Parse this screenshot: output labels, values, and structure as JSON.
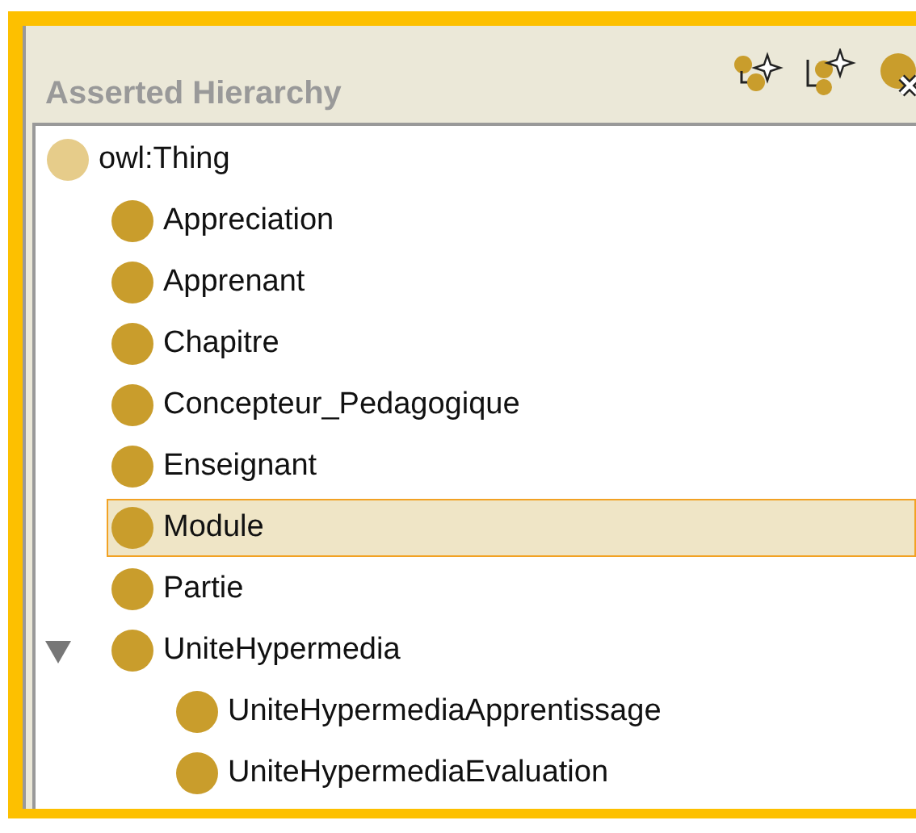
{
  "panel": {
    "title": "Asserted Hierarchy"
  },
  "tree": {
    "label": "owl:Thing",
    "selected": false,
    "children": [
      {
        "label": "Appreciation",
        "selected": false
      },
      {
        "label": "Apprenant",
        "selected": false
      },
      {
        "label": "Chapitre",
        "selected": false
      },
      {
        "label": "Concepteur_Pedagogique",
        "selected": false
      },
      {
        "label": "Enseignant",
        "selected": false
      },
      {
        "label": "Module",
        "selected": true
      },
      {
        "label": "Partie",
        "selected": false
      },
      {
        "label": "UniteHypermedia",
        "selected": false,
        "expanded": true,
        "children": [
          {
            "label": "UniteHypermediaApprentissage",
            "selected": false
          },
          {
            "label": "UniteHypermediaEvaluation",
            "selected": false
          }
        ]
      }
    ]
  }
}
